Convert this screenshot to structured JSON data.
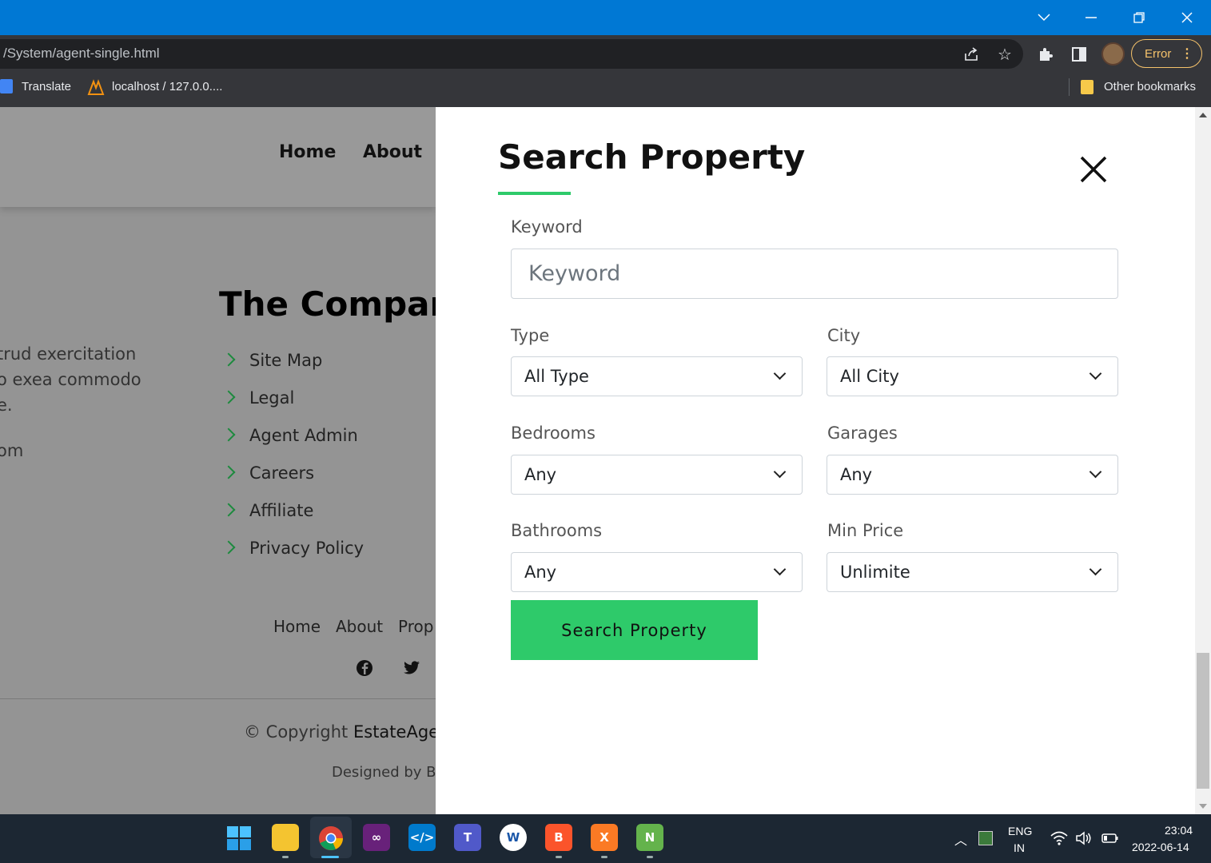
{
  "browser": {
    "url": "/System/agent-single.html",
    "error_label": "Error",
    "bookmarks": [
      {
        "label": "Translate"
      },
      {
        "label": "localhost / 127.0.0...."
      }
    ],
    "other_bookmarks": "Other bookmarks"
  },
  "page": {
    "nav": [
      "Home",
      "About"
    ],
    "company_heading": "The Compan",
    "body_lines": [
      "trud exercitation",
      "o exea commodo",
      "e.",
      "om"
    ],
    "links": [
      "Site Map",
      "Legal",
      "Agent Admin",
      "Careers",
      "Affiliate",
      "Privacy Policy"
    ],
    "footer_nav": [
      "Home",
      "About",
      "Prop"
    ],
    "copyright_prefix": "© Copyright",
    "copyright_brand": "EstateAger",
    "designed_by": "Designed by B"
  },
  "panel": {
    "title": "Search Property",
    "keyword_label": "Keyword",
    "keyword_placeholder": "Keyword",
    "type_label": "Type",
    "type_value": "All Type",
    "city_label": "City",
    "city_value": "All City",
    "bedrooms_label": "Bedrooms",
    "bedrooms_value": "Any",
    "garages_label": "Garages",
    "garages_value": "Any",
    "bathrooms_label": "Bathrooms",
    "bathrooms_value": "Any",
    "minprice_label": "Min Price",
    "minprice_value": "Unlimite",
    "search_button": "Search Property"
  },
  "taskbar": {
    "lang": "ENG",
    "region": "IN",
    "time": "23:04",
    "date": "2022-06-14"
  },
  "colors": {
    "accent": "#2eca6a",
    "titlebar": "#0078d4"
  }
}
